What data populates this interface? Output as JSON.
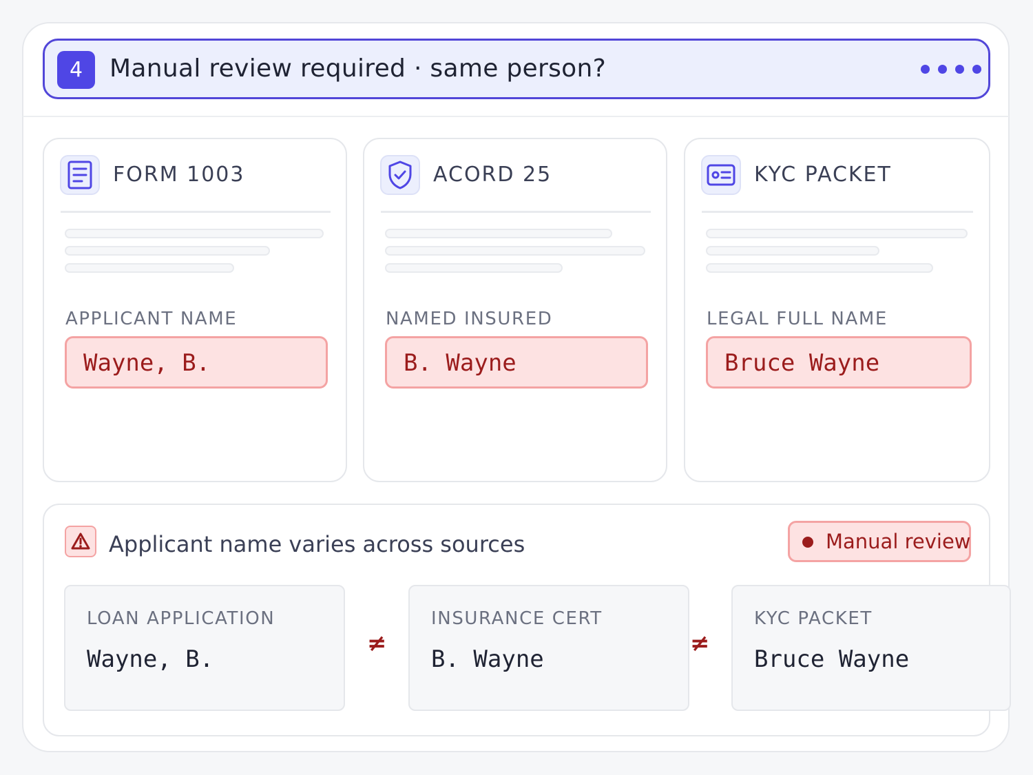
{
  "header": {
    "step_number": "4",
    "title": "Manual review required · same person?",
    "menu_icon": "more-dots-icon",
    "accent_color": "#4f46e5"
  },
  "documents": [
    {
      "icon": "document-lines-icon",
      "title": "FORM 1003",
      "field_label": "APPLICANT NAME",
      "field_value": "Wayne, B."
    },
    {
      "icon": "shield-check-icon",
      "title": "ACORD 25",
      "field_label": "NAMED INSURED",
      "field_value": "B. Wayne"
    },
    {
      "icon": "id-card-icon",
      "title": "KYC PACKET",
      "field_label": "LEGAL FULL NAME",
      "field_value": "Bruce Wayne"
    }
  ],
  "alert": {
    "icon": "warning-triangle-icon",
    "title": "Applicant name varies across sources",
    "status_badge": "Manual review",
    "status_color": "#9b1c1c",
    "sources": [
      {
        "label": "LOAN APPLICATION",
        "value": "Wayne, B."
      },
      {
        "label": "INSURANCE CERT",
        "value": "B. Wayne"
      },
      {
        "label": "KYC PACKET",
        "value": "Bruce Wayne"
      }
    ],
    "separator": "≠"
  }
}
